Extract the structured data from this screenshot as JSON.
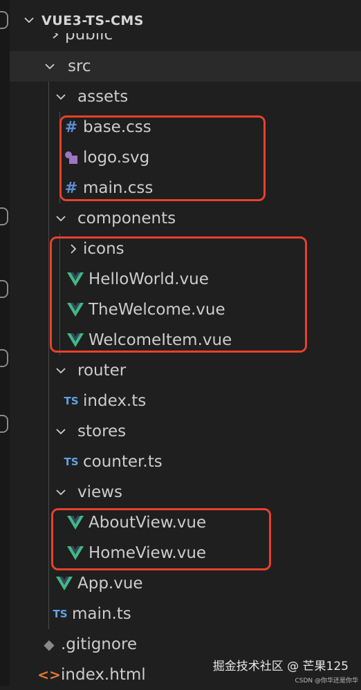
{
  "explorer": {
    "project_title": "VUE3-TS-CMS",
    "items": [
      {
        "label": "public",
        "kind": "folder-collapsed"
      },
      {
        "label": "src",
        "kind": "folder-open"
      },
      {
        "label": "assets",
        "kind": "folder-open"
      },
      {
        "label": "base.css",
        "kind": "css"
      },
      {
        "label": "logo.svg",
        "kind": "svg"
      },
      {
        "label": "main.css",
        "kind": "css"
      },
      {
        "label": "components",
        "kind": "folder-open"
      },
      {
        "label": "icons",
        "kind": "folder-collapsed"
      },
      {
        "label": "HelloWorld.vue",
        "kind": "vue"
      },
      {
        "label": "TheWelcome.vue",
        "kind": "vue"
      },
      {
        "label": "WelcomeItem.vue",
        "kind": "vue"
      },
      {
        "label": "router",
        "kind": "folder-open"
      },
      {
        "label": "index.ts",
        "kind": "ts"
      },
      {
        "label": "stores",
        "kind": "folder-open"
      },
      {
        "label": "counter.ts",
        "kind": "ts"
      },
      {
        "label": "views",
        "kind": "folder-open"
      },
      {
        "label": "AboutView.vue",
        "kind": "vue"
      },
      {
        "label": "HomeView.vue",
        "kind": "vue"
      },
      {
        "label": "App.vue",
        "kind": "vue"
      },
      {
        "label": "main.ts",
        "kind": "ts"
      },
      {
        "label": ".gitignore",
        "kind": "gitignore"
      },
      {
        "label": "index.html",
        "kind": "html"
      }
    ],
    "icon_glyphs": {
      "css": "#",
      "ts": "TS",
      "gitignore": "◆",
      "html": "<>"
    }
  },
  "watermark": {
    "text": "掘金技术社区 @ 芒果125",
    "small": "CSDN @你华还是你华"
  },
  "colors": {
    "background": "#1f1f1f",
    "highlight_box": "#e8412c",
    "vue_green": "#41b883",
    "ts_blue": "#5ea4e6",
    "css_blue": "#5b8fd6",
    "svg_purple": "#a074c4",
    "html_orange": "#e37933"
  }
}
